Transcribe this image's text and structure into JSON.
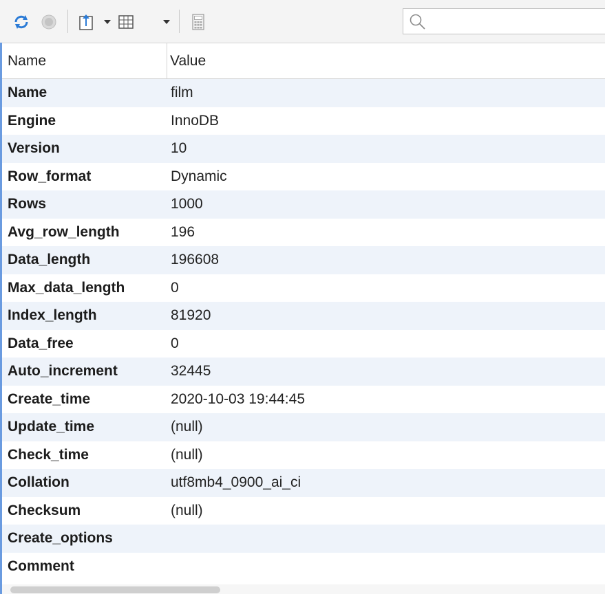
{
  "toolbar": {
    "icons": [
      "refresh-icon",
      "stop-icon",
      "export-icon",
      "dropdown-icon",
      "grid-view-icon",
      "dropdown-icon",
      "calculator-icon"
    ],
    "search": {
      "placeholder": "",
      "value": ""
    }
  },
  "table": {
    "columns": [
      "Name",
      "Value"
    ],
    "rows": [
      {
        "name": "Name",
        "value": "film"
      },
      {
        "name": "Engine",
        "value": "InnoDB"
      },
      {
        "name": "Version",
        "value": "10"
      },
      {
        "name": "Row_format",
        "value": "Dynamic"
      },
      {
        "name": "Rows",
        "value": "1000"
      },
      {
        "name": "Avg_row_length",
        "value": "196"
      },
      {
        "name": "Data_length",
        "value": "196608"
      },
      {
        "name": "Max_data_length",
        "value": "0"
      },
      {
        "name": "Index_length",
        "value": "81920"
      },
      {
        "name": "Data_free",
        "value": "0"
      },
      {
        "name": "Auto_increment",
        "value": "32445"
      },
      {
        "name": "Create_time",
        "value": "2020-10-03 19:44:45"
      },
      {
        "name": "Update_time",
        "value": "(null)"
      },
      {
        "name": "Check_time",
        "value": "(null)"
      },
      {
        "name": "Collation",
        "value": "utf8mb4_0900_ai_ci"
      },
      {
        "name": "Checksum",
        "value": "(null)"
      },
      {
        "name": "Create_options",
        "value": ""
      },
      {
        "name": "Comment",
        "value": ""
      }
    ]
  },
  "colors": {
    "accent": "#6a9be0",
    "alt_row": "#eef3fa",
    "refresh": "#2b7bd6"
  }
}
